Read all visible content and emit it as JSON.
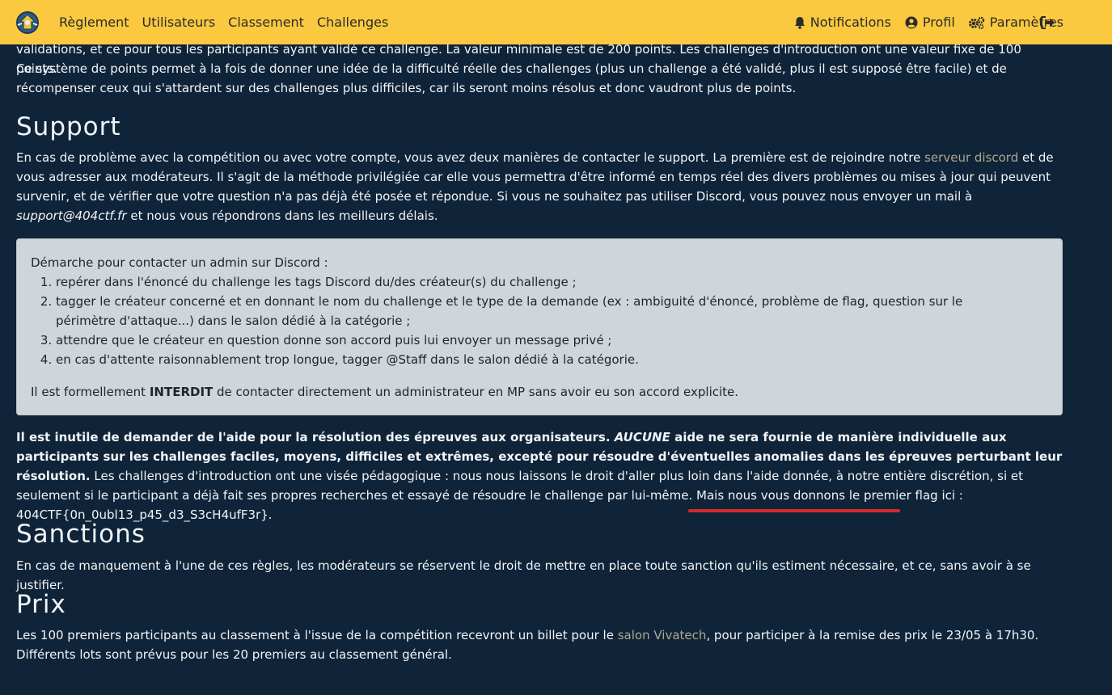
{
  "navbar": {
    "left_items": [
      "Règlement",
      "Utilisateurs",
      "Classement",
      "Challenges"
    ],
    "notifications": "Notifications",
    "profil": "Profil",
    "parametres": "Paramètres"
  },
  "points": {
    "line1": "validations, et ce pour tous les participants ayant validé ce challenge. La valeur minimale est de 200 points. Les challenges d'introduction ont une valeur fixe de 100 points.",
    "line2": "Ce système de points permet à la fois de donner une idée de la difficulté réelle des challenges (plus un challenge a été validé, plus il est supposé être facile) et de récompenser ceux qui s'attardent sur des challenges plus difficiles, car ils seront moins résolus et donc vaudront plus de points."
  },
  "support": {
    "title": "Support",
    "p1": "En cas de problème avec la compétition ou avec votre compte, vous avez deux manières de contacter le support. La première est de rejoindre notre ",
    "discord_link": "serveur discord",
    "p2": " et de vous adresser aux modérateurs. Il s'agit de la méthode privilégiée car elle vous permettra d'être informé en temps réel des divers problèmes ou mises à jour qui peuvent survenir, et de vérifier que votre question n'a pas déjà été posée et répondue. Si vous ne souhaitez pas utiliser Discord, vous pouvez nous envoyer un mail à ",
    "email": "support@404ctf.fr",
    "p3": " et nous vous répondrons dans les meilleurs délais."
  },
  "box": {
    "intro": "Démarche pour contacter un admin sur Discord :",
    "steps": [
      "repérer dans l'énoncé du challenge les tags Discord du/des créateur(s) du challenge ;",
      "tagger le créateur concerné et en donnant le nom du challenge et le type de la demande (ex : ambiguité d'énoncé, problème de flag, question sur le périmètre d'attaque...) dans le salon dédié à la catégorie ;",
      "attendre que le créateur en question donne son accord puis lui envoyer un message privé ;",
      "en cas d'attente raisonnablement trop longue, tagger @Staff dans le salon dédié à la catégorie."
    ],
    "warn_a": "Il est formellement ",
    "warn_b": "INTERDIT",
    "warn_c": " de contacter directement un administrateur en MP sans avoir eu son accord explicite."
  },
  "aide": {
    "bold_a": "Il est inutile de demander de l'aide pour la résolution des épreuves aux organisateurs. ",
    "bold_em": "AUCUNE",
    "bold_b": " aide ne sera fournie de manière individuelle aux participants sur les challenges faciles, moyens, difficiles et extrêmes, excepté pour résoudre d'éventuelles anomalies dans les épreuves perturbant leur résolution.",
    "rest": " Les challenges d'introduction ont une visée pédagogique : nous nous laissons le droit d'aller plus loin dans l'aide donnée, à notre entière discrétion, si et seulement si le participant a déjà fait ses propres recherches et essayé de résoudre le challenge par lui-même. Mais nous vous donnons le premier flag ici : ",
    "flag": "404CTF{0n_0ubl13_p45_d3_S3cH4ufF3r}",
    "end": "."
  },
  "sanctions": {
    "title": "Sanctions",
    "text": "En cas de manquement à l'une de ces règles, les modérateurs se réservent le droit de mettre en place toute sanction qu'ils estiment nécessaire, et ce, sans avoir à se justifier."
  },
  "prix": {
    "title": "Prix",
    "p1": "Les 100 premiers participants au classement à l'issue de la compétition recevront un billet pour le ",
    "link": "salon Vivatech",
    "p2": ", pour participer à la remise des prix le 23/05 à 17h30. Différents lots sont prévus pour les 20 premiers au classement général."
  },
  "colors": {
    "navbar": "#fbc93f",
    "background": "#0f2439",
    "link": "#b3a68a",
    "box": "#cfd6db",
    "flag_underline": "#d42a2a"
  }
}
